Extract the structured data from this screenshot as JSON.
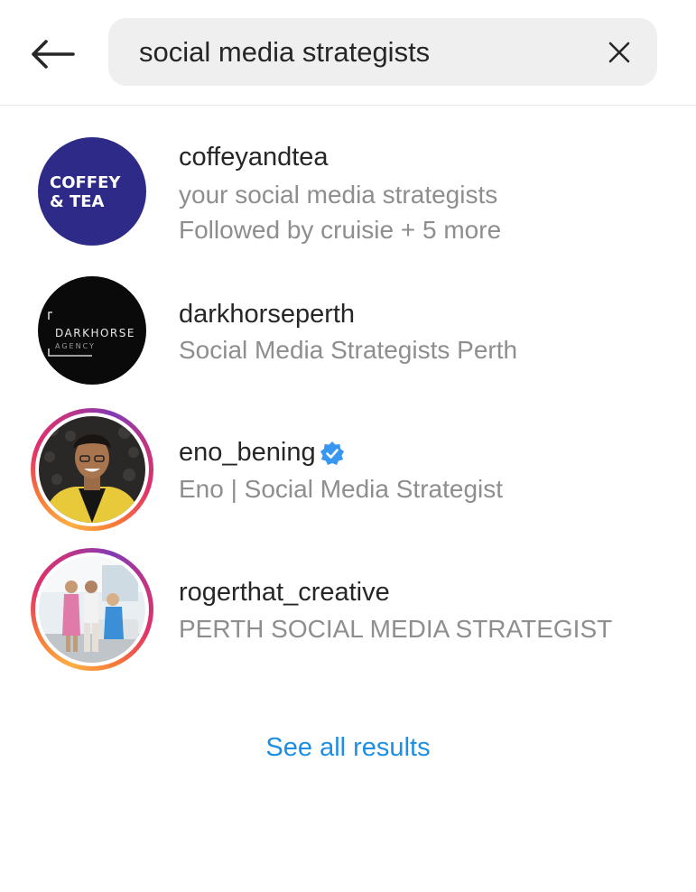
{
  "search": {
    "value": "social media strategists"
  },
  "results": [
    {
      "username": "coffeyandtea",
      "subtitle": "your social media strategists",
      "followed_by": "Followed by cruisie + 5 more",
      "avatar_text_line1": "COFFEY",
      "avatar_text_line2": "& TEA",
      "avatar_color": "#2e2a87",
      "has_story": false
    },
    {
      "username": "darkhorseperth",
      "subtitle": "Social Media Strategists Perth",
      "avatar_text_line1": "DARKHORSE",
      "avatar_text_line2": "AGENCY",
      "avatar_color": "#0a0a0a",
      "has_story": false
    },
    {
      "username": "eno_bening",
      "subtitle": "Eno | Social Media Strategist",
      "verified": true,
      "has_story": true
    },
    {
      "username": "rogerthat_creative",
      "subtitle": "PERTH SOCIAL MEDIA STRATEGIST",
      "has_story": true
    }
  ],
  "see_all_label": "See all results",
  "colors": {
    "link": "#1c8fe3",
    "verified": "#3897f0",
    "search_bg": "#efefef"
  }
}
